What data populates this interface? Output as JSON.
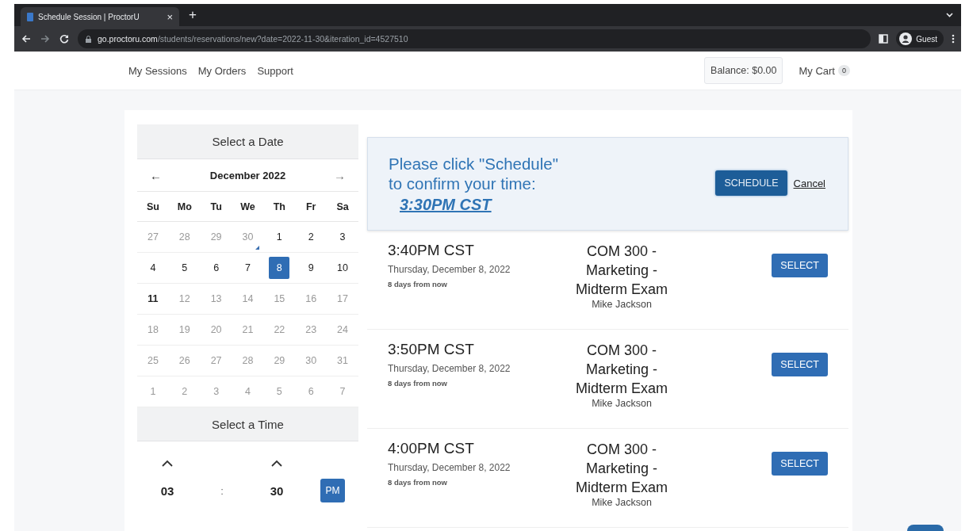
{
  "browser": {
    "tab_title": "Schedule Session | ProctorU",
    "close": "×",
    "new_tab": "+",
    "url_host": "go.proctoru.com",
    "url_path": "/students/reservations/new?date=2022-11-30&iteration_id=4527510",
    "profile": "Guest"
  },
  "nav": {
    "links": [
      "My Sessions",
      "My Orders",
      "Support"
    ],
    "balance": "Balance: $0.00",
    "cart": "My Cart",
    "cart_count": "0"
  },
  "calendar": {
    "title": "Select a Date",
    "prev": "←",
    "month": "December 2022",
    "next": "→",
    "weekdays": [
      "Su",
      "Mo",
      "Tu",
      "We",
      "Th",
      "Fr",
      "Sa"
    ],
    "weeks": [
      [
        {
          "day": "27",
          "available": false,
          "selected": false
        },
        {
          "day": "28",
          "available": false,
          "selected": false
        },
        {
          "day": "29",
          "available": false,
          "selected": false
        },
        {
          "day": "30",
          "available": false,
          "selected": false,
          "today": true
        },
        {
          "day": "1",
          "available": true,
          "selected": false
        },
        {
          "day": "2",
          "available": true,
          "selected": false
        },
        {
          "day": "3",
          "available": true,
          "selected": false
        }
      ],
      [
        {
          "day": "4",
          "available": true,
          "selected": false
        },
        {
          "day": "5",
          "available": true,
          "selected": false
        },
        {
          "day": "6",
          "available": true,
          "selected": false
        },
        {
          "day": "7",
          "available": true,
          "selected": false
        },
        {
          "day": "8",
          "available": true,
          "selected": true
        },
        {
          "day": "9",
          "available": true,
          "selected": false
        },
        {
          "day": "10",
          "available": true,
          "selected": false
        }
      ],
      [
        {
          "day": "11",
          "available": true,
          "selected": false,
          "emphasized": true
        },
        {
          "day": "12",
          "available": false,
          "selected": false
        },
        {
          "day": "13",
          "available": false,
          "selected": false
        },
        {
          "day": "14",
          "available": false,
          "selected": false
        },
        {
          "day": "15",
          "available": false,
          "selected": false
        },
        {
          "day": "16",
          "available": false,
          "selected": false
        },
        {
          "day": "17",
          "available": false,
          "selected": false
        }
      ],
      [
        {
          "day": "18",
          "available": false,
          "selected": false
        },
        {
          "day": "19",
          "available": false,
          "selected": false
        },
        {
          "day": "20",
          "available": false,
          "selected": false
        },
        {
          "day": "21",
          "available": false,
          "selected": false
        },
        {
          "day": "22",
          "available": false,
          "selected": false
        },
        {
          "day": "23",
          "available": false,
          "selected": false
        },
        {
          "day": "24",
          "available": false,
          "selected": false
        }
      ],
      [
        {
          "day": "25",
          "available": false,
          "selected": false
        },
        {
          "day": "26",
          "available": false,
          "selected": false
        },
        {
          "day": "27",
          "available": false,
          "selected": false
        },
        {
          "day": "28",
          "available": false,
          "selected": false
        },
        {
          "day": "29",
          "available": false,
          "selected": false
        },
        {
          "day": "30",
          "available": false,
          "selected": false
        },
        {
          "day": "31",
          "available": false,
          "selected": false
        }
      ],
      [
        {
          "day": "1",
          "available": false,
          "selected": false
        },
        {
          "day": "2",
          "available": false,
          "selected": false
        },
        {
          "day": "3",
          "available": false,
          "selected": false
        },
        {
          "day": "4",
          "available": false,
          "selected": false
        },
        {
          "day": "5",
          "available": false,
          "selected": false
        },
        {
          "day": "6",
          "available": false,
          "selected": false
        },
        {
          "day": "7",
          "available": false,
          "selected": false
        }
      ]
    ]
  },
  "time_picker": {
    "title": "Select a Time",
    "hour": "03",
    "separator": ":",
    "minute": "30",
    "meridiem": "PM"
  },
  "confirm": {
    "line1": "Please click \"Schedule\"",
    "line2": "to confirm your time:",
    "time": "3:30PM CST",
    "schedule": "SCHEDULE",
    "cancel": "Cancel"
  },
  "sessions": [
    {
      "time": "3:40PM CST",
      "date": "Thursday, December 8, 2022",
      "relative": "8 days from now",
      "exam": "COM 300 - Marketing - Midterm Exam",
      "instructor": "Mike Jackson",
      "button": "SELECT"
    },
    {
      "time": "3:50PM CST",
      "date": "Thursday, December 8, 2022",
      "relative": "8 days from now",
      "exam": "COM 300 - Marketing - Midterm Exam",
      "instructor": "Mike Jackson",
      "button": "SELECT"
    },
    {
      "time": "4:00PM CST",
      "date": "Thursday, December 8, 2022",
      "relative": "8 days from now",
      "exam": "COM 300 - Marketing - Midterm Exam",
      "instructor": "Mike Jackson",
      "button": "SELECT"
    }
  ]
}
